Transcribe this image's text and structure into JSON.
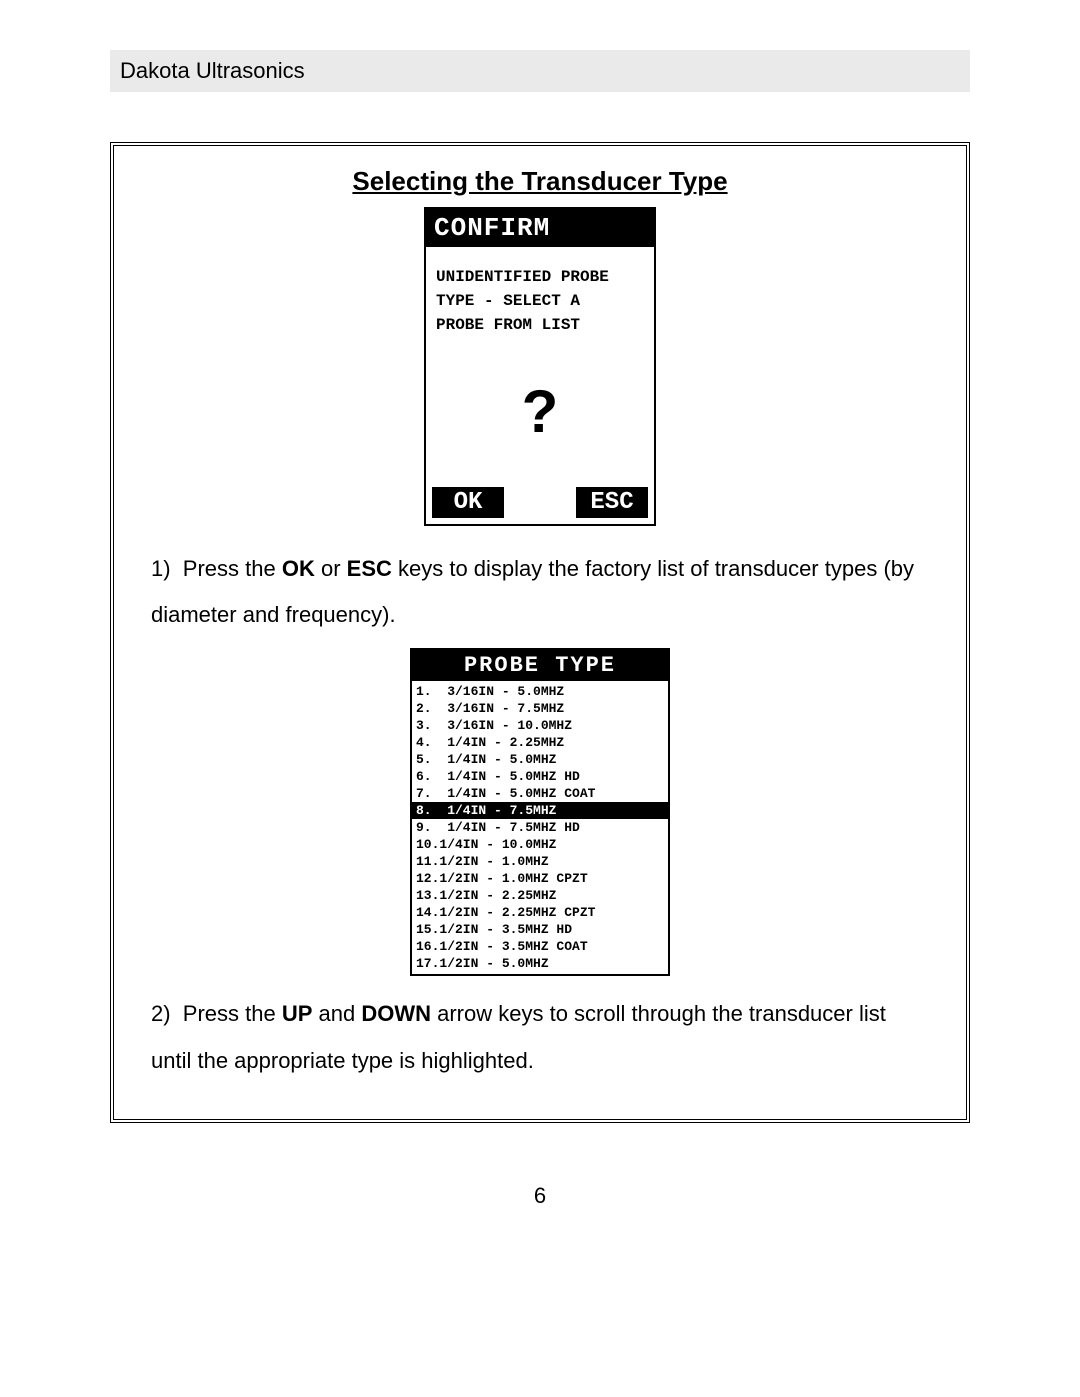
{
  "header": "Dakota Ultrasonics",
  "section_title": "Selecting the Transducer Type",
  "confirm": {
    "title": "CONFIRM",
    "line1": "UNIDENTIFIED PROBE",
    "line2": "TYPE - SELECT A",
    "line3": "PROBE FROM LIST",
    "qmark": "?",
    "ok": "OK",
    "esc": "ESC"
  },
  "step1": {
    "num": "1)",
    "a": "Press the ",
    "ok": "OK",
    "b": " or ",
    "esc": "ESC",
    "c": " keys to display the factory list of transducer types (by diameter and frequency)."
  },
  "probe": {
    "title": "PROBE TYPE",
    "items": [
      {
        "n": "1.",
        "t": " 3/16IN - 5.0MHZ"
      },
      {
        "n": "2.",
        "t": " 3/16IN - 7.5MHZ"
      },
      {
        "n": "3.",
        "t": " 3/16IN - 10.0MHZ"
      },
      {
        "n": "4.",
        "t": " 1/4IN - 2.25MHZ"
      },
      {
        "n": "5.",
        "t": " 1/4IN - 5.0MHZ"
      },
      {
        "n": "6.",
        "t": " 1/4IN - 5.0MHZ HD"
      },
      {
        "n": "7.",
        "t": " 1/4IN - 5.0MHZ COAT"
      },
      {
        "n": "8.",
        "t": " 1/4IN - 7.5MHZ"
      },
      {
        "n": "9.",
        "t": " 1/4IN - 7.5MHZ HD"
      },
      {
        "n": "10.",
        "t": "1/4IN - 10.0MHZ"
      },
      {
        "n": "11.",
        "t": "1/2IN - 1.0MHZ"
      },
      {
        "n": "12.",
        "t": "1/2IN - 1.0MHZ CPZT"
      },
      {
        "n": "13.",
        "t": "1/2IN - 2.25MHZ"
      },
      {
        "n": "14.",
        "t": "1/2IN - 2.25MHZ CPZT"
      },
      {
        "n": "15.",
        "t": "1/2IN - 3.5MHZ HD"
      },
      {
        "n": "16.",
        "t": "1/2IN - 3.5MHZ COAT"
      },
      {
        "n": "17.",
        "t": "1/2IN - 5.0MHZ"
      }
    ],
    "selected_index": 7
  },
  "step2": {
    "num": "2)",
    "a": "Press the ",
    "up": "UP",
    "b": " and ",
    "down": "DOWN",
    "c": " arrow keys to scroll through the transducer list until the appropriate type is highlighted."
  },
  "page_number": "6"
}
